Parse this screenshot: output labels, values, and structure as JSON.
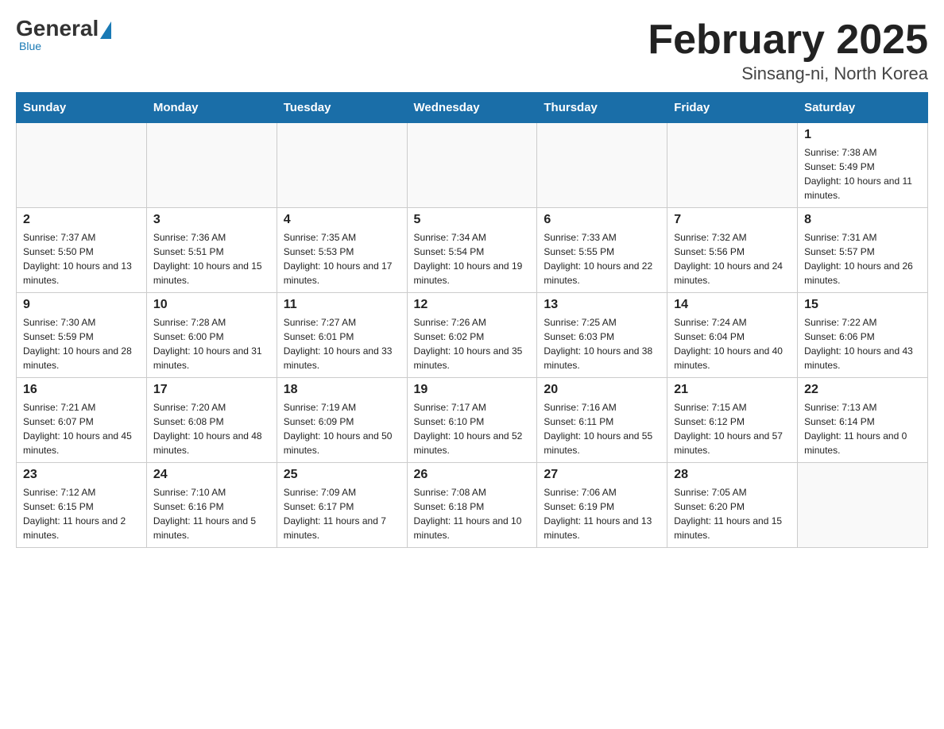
{
  "logo": {
    "general": "General",
    "blue": "Blue",
    "subtitle": "Blue"
  },
  "title": "February 2025",
  "subtitle": "Sinsang-ni, North Korea",
  "days_of_week": [
    "Sunday",
    "Monday",
    "Tuesday",
    "Wednesday",
    "Thursday",
    "Friday",
    "Saturday"
  ],
  "weeks": [
    [
      {
        "day": "",
        "info": ""
      },
      {
        "day": "",
        "info": ""
      },
      {
        "day": "",
        "info": ""
      },
      {
        "day": "",
        "info": ""
      },
      {
        "day": "",
        "info": ""
      },
      {
        "day": "",
        "info": ""
      },
      {
        "day": "1",
        "info": "Sunrise: 7:38 AM\nSunset: 5:49 PM\nDaylight: 10 hours and 11 minutes."
      }
    ],
    [
      {
        "day": "2",
        "info": "Sunrise: 7:37 AM\nSunset: 5:50 PM\nDaylight: 10 hours and 13 minutes."
      },
      {
        "day": "3",
        "info": "Sunrise: 7:36 AM\nSunset: 5:51 PM\nDaylight: 10 hours and 15 minutes."
      },
      {
        "day": "4",
        "info": "Sunrise: 7:35 AM\nSunset: 5:53 PM\nDaylight: 10 hours and 17 minutes."
      },
      {
        "day": "5",
        "info": "Sunrise: 7:34 AM\nSunset: 5:54 PM\nDaylight: 10 hours and 19 minutes."
      },
      {
        "day": "6",
        "info": "Sunrise: 7:33 AM\nSunset: 5:55 PM\nDaylight: 10 hours and 22 minutes."
      },
      {
        "day": "7",
        "info": "Sunrise: 7:32 AM\nSunset: 5:56 PM\nDaylight: 10 hours and 24 minutes."
      },
      {
        "day": "8",
        "info": "Sunrise: 7:31 AM\nSunset: 5:57 PM\nDaylight: 10 hours and 26 minutes."
      }
    ],
    [
      {
        "day": "9",
        "info": "Sunrise: 7:30 AM\nSunset: 5:59 PM\nDaylight: 10 hours and 28 minutes."
      },
      {
        "day": "10",
        "info": "Sunrise: 7:28 AM\nSunset: 6:00 PM\nDaylight: 10 hours and 31 minutes."
      },
      {
        "day": "11",
        "info": "Sunrise: 7:27 AM\nSunset: 6:01 PM\nDaylight: 10 hours and 33 minutes."
      },
      {
        "day": "12",
        "info": "Sunrise: 7:26 AM\nSunset: 6:02 PM\nDaylight: 10 hours and 35 minutes."
      },
      {
        "day": "13",
        "info": "Sunrise: 7:25 AM\nSunset: 6:03 PM\nDaylight: 10 hours and 38 minutes."
      },
      {
        "day": "14",
        "info": "Sunrise: 7:24 AM\nSunset: 6:04 PM\nDaylight: 10 hours and 40 minutes."
      },
      {
        "day": "15",
        "info": "Sunrise: 7:22 AM\nSunset: 6:06 PM\nDaylight: 10 hours and 43 minutes."
      }
    ],
    [
      {
        "day": "16",
        "info": "Sunrise: 7:21 AM\nSunset: 6:07 PM\nDaylight: 10 hours and 45 minutes."
      },
      {
        "day": "17",
        "info": "Sunrise: 7:20 AM\nSunset: 6:08 PM\nDaylight: 10 hours and 48 minutes."
      },
      {
        "day": "18",
        "info": "Sunrise: 7:19 AM\nSunset: 6:09 PM\nDaylight: 10 hours and 50 minutes."
      },
      {
        "day": "19",
        "info": "Sunrise: 7:17 AM\nSunset: 6:10 PM\nDaylight: 10 hours and 52 minutes."
      },
      {
        "day": "20",
        "info": "Sunrise: 7:16 AM\nSunset: 6:11 PM\nDaylight: 10 hours and 55 minutes."
      },
      {
        "day": "21",
        "info": "Sunrise: 7:15 AM\nSunset: 6:12 PM\nDaylight: 10 hours and 57 minutes."
      },
      {
        "day": "22",
        "info": "Sunrise: 7:13 AM\nSunset: 6:14 PM\nDaylight: 11 hours and 0 minutes."
      }
    ],
    [
      {
        "day": "23",
        "info": "Sunrise: 7:12 AM\nSunset: 6:15 PM\nDaylight: 11 hours and 2 minutes."
      },
      {
        "day": "24",
        "info": "Sunrise: 7:10 AM\nSunset: 6:16 PM\nDaylight: 11 hours and 5 minutes."
      },
      {
        "day": "25",
        "info": "Sunrise: 7:09 AM\nSunset: 6:17 PM\nDaylight: 11 hours and 7 minutes."
      },
      {
        "day": "26",
        "info": "Sunrise: 7:08 AM\nSunset: 6:18 PM\nDaylight: 11 hours and 10 minutes."
      },
      {
        "day": "27",
        "info": "Sunrise: 7:06 AM\nSunset: 6:19 PM\nDaylight: 11 hours and 13 minutes."
      },
      {
        "day": "28",
        "info": "Sunrise: 7:05 AM\nSunset: 6:20 PM\nDaylight: 11 hours and 15 minutes."
      },
      {
        "day": "",
        "info": ""
      }
    ]
  ]
}
